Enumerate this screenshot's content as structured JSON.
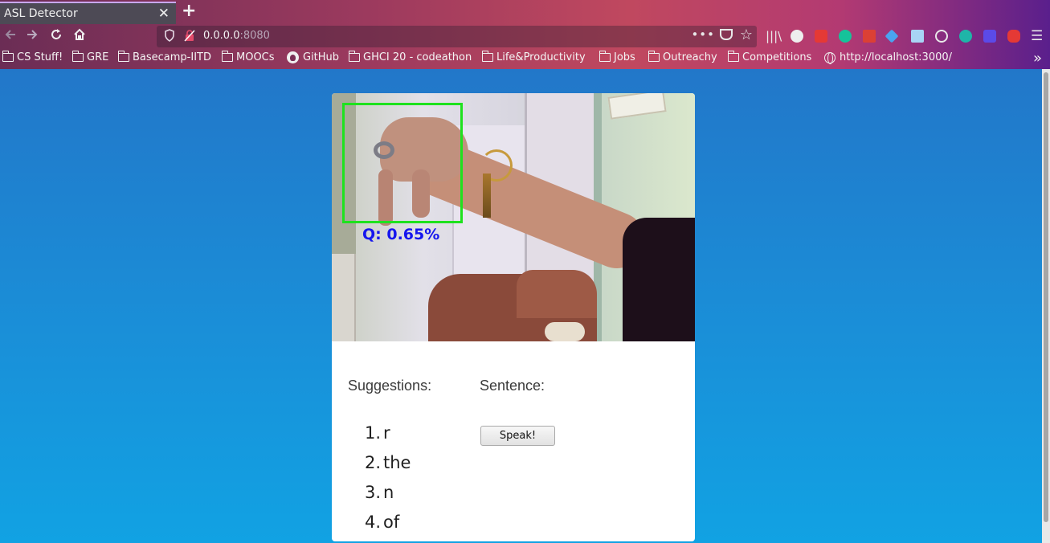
{
  "browser": {
    "tab_title": "ASL Detector",
    "tab_close": "✕",
    "new_tab": "+",
    "url_host": "0.0.0.0",
    "url_port": ":8080",
    "url_more": "•••",
    "bookmarks": [
      {
        "label": "CS Stuff!",
        "icon": "folder-icon"
      },
      {
        "label": "GRE",
        "icon": "folder-icon"
      },
      {
        "label": "Basecamp-IITD",
        "icon": "folder-icon"
      },
      {
        "label": "MOOCs",
        "icon": "folder-icon"
      },
      {
        "label": "GitHub",
        "icon": "github-icon"
      },
      {
        "label": "GHCI 20 - codeathon",
        "icon": "folder-icon"
      },
      {
        "label": "Life&Productivity",
        "icon": "folder-icon"
      },
      {
        "label": "Jobs",
        "icon": "folder-icon"
      },
      {
        "label": "Outreachy",
        "icon": "folder-icon"
      },
      {
        "label": "Competitions",
        "icon": "folder-icon"
      },
      {
        "label": "http://localhost:3000/",
        "icon": "globe-icon"
      }
    ],
    "bookmarks_overflow": "»"
  },
  "app": {
    "prediction_label": "Q:  0.65%",
    "suggestions_label": "Suggestions:",
    "sentence_label": "Sentence:",
    "suggestions": [
      {
        "num": "1.",
        "word": "r"
      },
      {
        "num": "2.",
        "word": "the"
      },
      {
        "num": "3.",
        "word": "n"
      },
      {
        "num": "4.",
        "word": "of"
      }
    ],
    "speak_button": "Speak!",
    "colors": {
      "bbox": "#1ee21e",
      "prediction_text": "#1616ee",
      "video_bar": "#161552"
    }
  }
}
